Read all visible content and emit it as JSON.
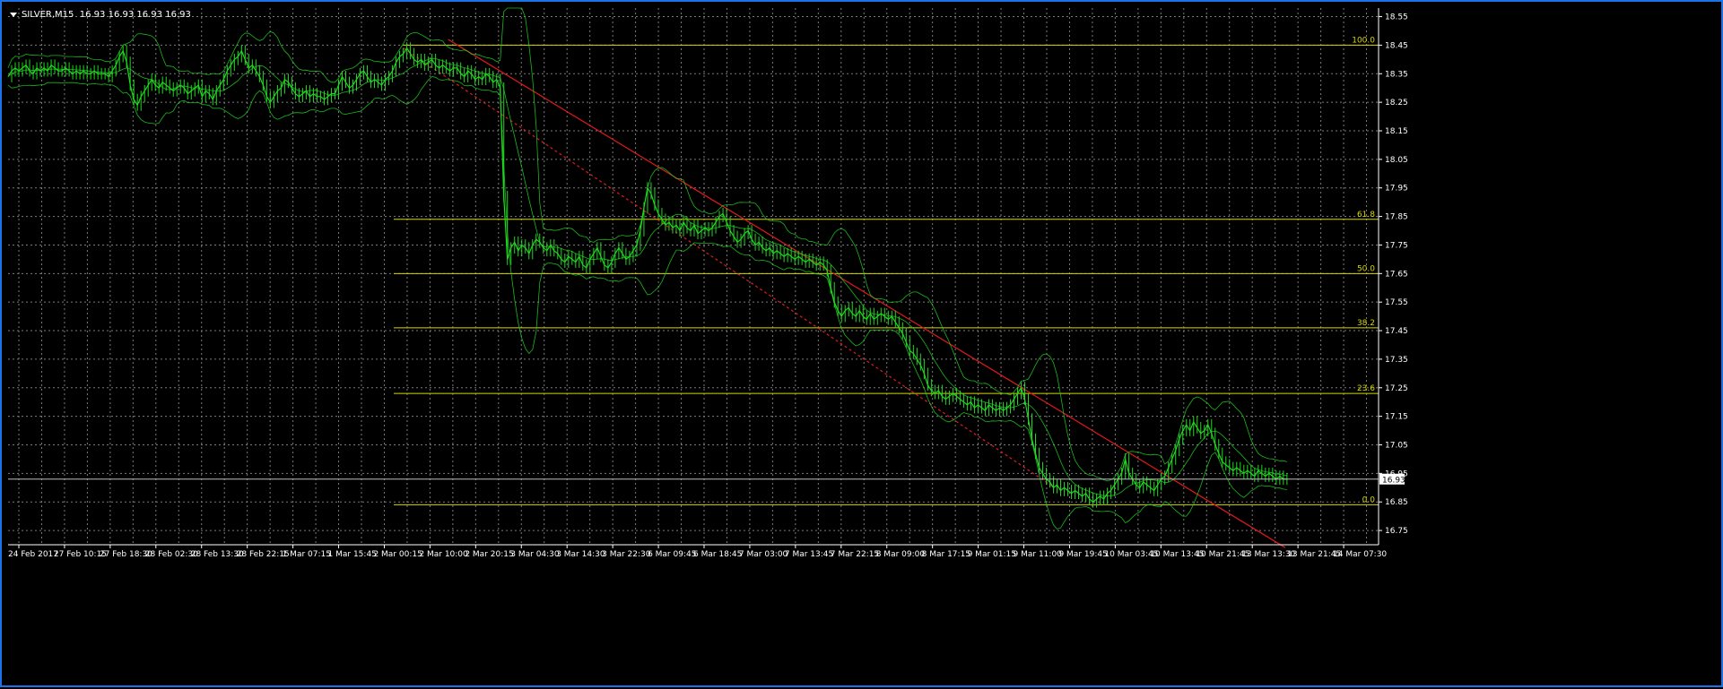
{
  "header": {
    "symbol": "SILVER,M15",
    "ohlc": "16.93 16.93 16.93 16.93"
  },
  "chart_data": {
    "type": "line",
    "subtype": "candlestick-price-chart",
    "title": "",
    "xlabel": "",
    "ylabel": "",
    "ylim": [
      16.7,
      18.58
    ],
    "grid": true,
    "current_price": 16.93,
    "current_price_label": "16.93",
    "y_ticks": [
      "18.55",
      "18.45",
      "18.35",
      "18.25",
      "18.15",
      "18.05",
      "17.95",
      "17.85",
      "17.75",
      "17.65",
      "17.55",
      "17.45",
      "17.35",
      "17.25",
      "17.15",
      "17.05",
      "16.95",
      "16.85",
      "16.75"
    ],
    "x_ticks": [
      "24 Feb 2017",
      "27 Feb 10:15",
      "27 Feb 18:30",
      "28 Feb 02:30",
      "28 Feb 13:30",
      "28 Feb 22:15",
      "1 Mar 07:15",
      "1 Mar 15:45",
      "2 Mar 00:15",
      "2 Mar 10:00",
      "2 Mar 20:15",
      "3 Mar 04:30",
      "3 Mar 14:30",
      "3 Mar 22:30",
      "6 Mar 09:45",
      "6 Mar 18:45",
      "7 Mar 03:00",
      "7 Mar 13:45",
      "7 Mar 22:15",
      "8 Mar 09:00",
      "8 Mar 17:15",
      "9 Mar 01:15",
      "9 Mar 11:00",
      "9 Mar 19:45",
      "10 Mar 03:45",
      "10 Mar 13:45",
      "10 Mar 21:45",
      "13 Mar 13:30",
      "13 Mar 21:45",
      "14 Mar 07:30"
    ],
    "fibonacci_levels": [
      {
        "label": "100.0",
        "price": 18.45
      },
      {
        "label": "61.8",
        "price": 17.84
      },
      {
        "label": "50.0",
        "price": 17.65
      },
      {
        "label": "38.2",
        "price": 17.46
      },
      {
        "label": "23.6",
        "price": 17.23
      },
      {
        "label": "0.0",
        "price": 16.84
      }
    ],
    "series": [
      {
        "x": [
          0,
          4,
          8,
          12,
          16,
          20,
          24,
          28,
          32,
          36,
          40,
          44,
          48,
          52,
          56,
          60,
          64,
          68,
          72,
          76,
          80,
          84,
          88,
          92,
          96,
          100,
          104,
          108,
          112,
          116,
          120,
          124,
          128,
          132,
          136,
          140,
          144,
          148,
          152,
          156,
          160,
          164,
          168,
          172,
          176,
          180,
          184,
          188,
          192,
          196,
          200,
          204,
          208,
          212,
          216,
          220,
          224,
          228,
          232,
          236,
          240,
          244,
          248,
          252,
          256,
          260,
          264,
          268,
          272,
          276,
          280,
          284,
          288,
          292,
          296,
          300,
          304,
          308,
          312,
          316,
          320,
          324,
          328,
          332,
          336,
          340,
          344,
          348,
          352,
          356,
          360,
          364,
          368,
          372,
          376,
          380,
          384,
          388,
          392,
          396,
          400,
          404,
          408,
          412,
          416,
          420,
          424,
          428,
          432,
          436,
          440,
          444,
          448,
          452,
          456,
          460,
          464,
          468,
          472,
          476,
          480,
          484,
          488,
          492,
          496,
          500,
          504,
          508,
          512,
          516,
          520,
          524,
          528,
          532,
          536,
          540,
          544,
          548,
          552,
          556,
          560,
          564,
          568,
          572,
          576,
          580,
          584,
          588,
          592,
          596,
          600,
          604,
          608,
          612,
          616,
          620,
          624,
          628,
          632,
          636,
          640,
          644,
          648,
          652,
          656,
          660,
          664,
          668,
          672,
          676,
          680,
          684,
          688,
          692,
          696,
          700,
          704,
          708,
          712,
          716,
          720,
          724,
          728,
          732,
          736,
          740,
          744,
          748,
          752,
          756,
          760,
          764,
          768,
          772,
          776,
          780,
          784,
          788,
          792,
          796,
          800,
          804,
          808,
          812,
          816,
          820,
          824,
          828,
          832,
          836,
          840,
          844,
          848,
          852,
          856,
          860,
          864,
          868,
          872,
          876,
          880,
          884,
          888,
          892,
          896,
          900,
          904,
          908,
          912,
          916,
          920,
          924,
          928,
          932,
          936,
          940,
          944,
          948,
          952,
          956,
          960,
          964,
          968,
          972,
          976,
          980,
          984,
          988,
          992,
          996,
          1000,
          1004,
          1008,
          1012,
          1016,
          1020,
          1024,
          1028,
          1032,
          1036,
          1040,
          1044,
          1048,
          1052,
          1056,
          1060,
          1064,
          1068,
          1072,
          1076,
          1080,
          1084,
          1088,
          1092,
          1096,
          1100,
          1104,
          1108,
          1112,
          1116,
          1120,
          1124,
          1128,
          1132,
          1136,
          1140,
          1144,
          1148,
          1152,
          1156,
          1160,
          1164,
          1168,
          1172,
          1176,
          1180,
          1184,
          1188,
          1192,
          1196,
          1200,
          1204,
          1208,
          1212,
          1216,
          1220,
          1224,
          1228,
          1232,
          1236,
          1240,
          1244,
          1248,
          1252,
          1256,
          1260,
          1264,
          1268,
          1272,
          1276,
          1280,
          1284,
          1288,
          1292,
          1296,
          1300,
          1304,
          1308,
          1312,
          1316,
          1320,
          1324,
          1328,
          1332,
          1336,
          1340,
          1344,
          1348,
          1352,
          1356,
          1360,
          1364,
          1368,
          1372,
          1376,
          1380,
          1384,
          1388,
          1392,
          1396,
          1400,
          1404,
          1408,
          1412,
          1416,
          1420,
          1424,
          1428,
          1432,
          1436,
          1440,
          1444,
          1448,
          1452,
          1456,
          1460,
          1464,
          1468,
          1472,
          1476,
          1480,
          1484,
          1488,
          1492,
          1496,
          1500,
          1504,
          1508,
          1512,
          1516,
          1520
        ],
        "name": "",
        "close": [
          18.34,
          18.36,
          18.37,
          18.36,
          18.37,
          18.38,
          18.36,
          18.35,
          18.37,
          18.36,
          18.37,
          18.36,
          18.38,
          18.37,
          18.36,
          18.36,
          18.37,
          18.36,
          18.35,
          18.36,
          18.35,
          18.36,
          18.35,
          18.35,
          18.36,
          18.35,
          18.35,
          18.35,
          18.34,
          18.36,
          18.38,
          18.41,
          18.43,
          18.39,
          18.31,
          18.26,
          18.24,
          18.27,
          18.29,
          18.31,
          18.33,
          18.31,
          18.3,
          18.32,
          18.31,
          18.3,
          18.29,
          18.3,
          18.31,
          18.3,
          18.28,
          18.29,
          18.3,
          18.31,
          18.27,
          18.29,
          18.28,
          18.26,
          18.29,
          18.31,
          18.33,
          18.36,
          18.38,
          18.4,
          18.41,
          18.43,
          18.4,
          18.37,
          18.38,
          18.36,
          18.34,
          18.31,
          18.27,
          18.25,
          18.27,
          18.29,
          18.3,
          18.33,
          18.32,
          18.3,
          18.28,
          18.27,
          18.28,
          18.29,
          18.27,
          18.28,
          18.27,
          18.27,
          18.26,
          18.27,
          18.28,
          18.28,
          18.31,
          18.34,
          18.32,
          18.3,
          18.31,
          18.33,
          18.35,
          18.36,
          18.34,
          18.32,
          18.33,
          18.32,
          18.31,
          18.33,
          18.34,
          18.36,
          18.39,
          18.41,
          18.42,
          18.44,
          18.42,
          18.4,
          18.39,
          18.4,
          18.38,
          18.39,
          18.4,
          18.38,
          18.37,
          18.38,
          18.37,
          18.36,
          18.37,
          18.37,
          18.35,
          18.34,
          18.36,
          18.35,
          18.33,
          18.34,
          18.33,
          18.35,
          18.34,
          18.32,
          18.33,
          18.3,
          17.92,
          17.7,
          17.74,
          17.76,
          17.73,
          17.75,
          17.74,
          17.72,
          17.75,
          17.77,
          17.76,
          17.74,
          17.73,
          17.75,
          17.73,
          17.72,
          17.7,
          17.69,
          17.71,
          17.7,
          17.69,
          17.71,
          17.68,
          17.67,
          17.7,
          17.72,
          17.74,
          17.71,
          17.68,
          17.67,
          17.69,
          17.72,
          17.74,
          17.72,
          17.7,
          17.71,
          17.73,
          17.75,
          17.8,
          17.88,
          17.95,
          17.93,
          17.89,
          17.86,
          17.84,
          17.82,
          17.83,
          17.81,
          17.82,
          17.8,
          17.83,
          17.81,
          17.8,
          17.82,
          17.79,
          17.8,
          17.81,
          17.8,
          17.81,
          17.83,
          17.85,
          17.86,
          17.83,
          17.8,
          17.78,
          17.76,
          17.77,
          17.79,
          17.8,
          17.77,
          17.75,
          17.76,
          17.74,
          17.73,
          17.74,
          17.72,
          17.73,
          17.72,
          17.71,
          17.72,
          17.71,
          17.7,
          17.71,
          17.7,
          17.69,
          17.7,
          17.69,
          17.68,
          17.69,
          17.68,
          17.66,
          17.6,
          17.55,
          17.52,
          17.5,
          17.52,
          17.53,
          17.51,
          17.5,
          17.52,
          17.5,
          17.49,
          17.51,
          17.49,
          17.5,
          17.51,
          17.5,
          17.49,
          17.5,
          17.48,
          17.46,
          17.44,
          17.41,
          17.38,
          17.37,
          17.35,
          17.33,
          17.3,
          17.26,
          17.24,
          17.23,
          17.24,
          17.22,
          17.21,
          17.22,
          17.23,
          17.22,
          17.21,
          17.2,
          17.19,
          17.2,
          17.18,
          17.19,
          17.18,
          17.17,
          17.19,
          17.18,
          17.17,
          17.18,
          17.17,
          17.18,
          17.19,
          17.21,
          17.23,
          17.25,
          17.21,
          17.14,
          17.07,
          17.02,
          16.97,
          16.95,
          16.93,
          16.92,
          16.9,
          16.91,
          16.89,
          16.9,
          16.89,
          16.88,
          16.89,
          16.88,
          16.87,
          16.88,
          16.86,
          16.85,
          16.86,
          16.87,
          16.86,
          16.88,
          16.89,
          16.91,
          16.93,
          16.95,
          17.0,
          16.95,
          16.93,
          16.91,
          16.9,
          16.92,
          16.91,
          16.9,
          16.89,
          16.91,
          16.93,
          16.94,
          16.97,
          17.0,
          17.03,
          17.07,
          17.1,
          17.12,
          17.1,
          17.13,
          17.11,
          17.09,
          17.1,
          17.12,
          17.09,
          17.05,
          17.02,
          16.99,
          16.98,
          16.97,
          16.96,
          16.97,
          16.96,
          16.95,
          16.96,
          16.95,
          16.94,
          16.96,
          16.95,
          16.94,
          16.95,
          16.94,
          16.93,
          16.94,
          16.93,
          16.93
        ]
      }
    ],
    "trendlines": [
      {
        "name": "",
        "style": "solid",
        "color": "#e01a1a",
        "from": [
          490,
          18.47
        ],
        "to": [
          1422,
          16.69
        ]
      },
      {
        "name": "",
        "style": "dashed",
        "color": "#e01a1a",
        "from": [
          440,
          18.44
        ],
        "to": [
          1165,
          16.9
        ]
      }
    ],
    "colors": {
      "price": "#1fd81f",
      "bands": "#1fd81f",
      "fib": "#d6d600",
      "trend": "#e01a1a",
      "grid": "#7b7b7b",
      "axis": "#ffffff"
    }
  }
}
